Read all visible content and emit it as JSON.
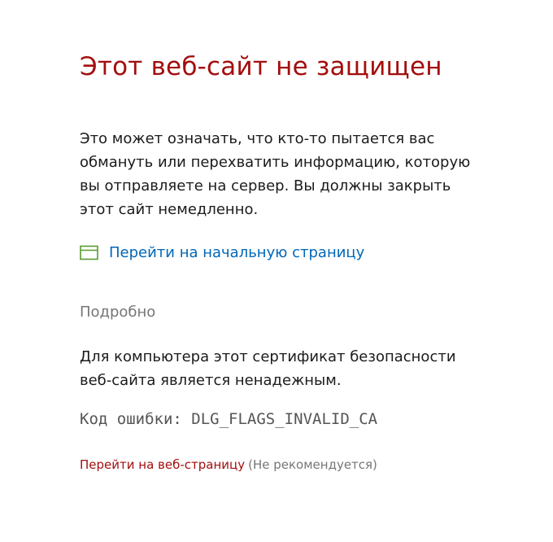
{
  "main": {
    "title": "Этот веб-сайт не защищен",
    "description": "Это может означать, что кто-то пытается вас обмануть или перехватить информацию, которую вы отправляете на сервер. Вы должны закрыть этот сайт немедленно.",
    "home_link_label": "Перейти на начальную страницу",
    "home_icon": "browser-window-icon",
    "details_label": "Подробно",
    "details_text": "Для компьютера этот сертификат безопасности веб-сайта является ненадежным.",
    "error_code_label": "Код ошибки:",
    "error_code": "DLG_FLAGS_INVALID_CA",
    "continue_link_label": "Перейти на веб-страницу",
    "not_recommended": "(Не рекомендуется)"
  },
  "colors": {
    "title": "#a30e0e",
    "link": "#0067b8",
    "muted": "#767676",
    "icon": "#5a9a2f"
  }
}
